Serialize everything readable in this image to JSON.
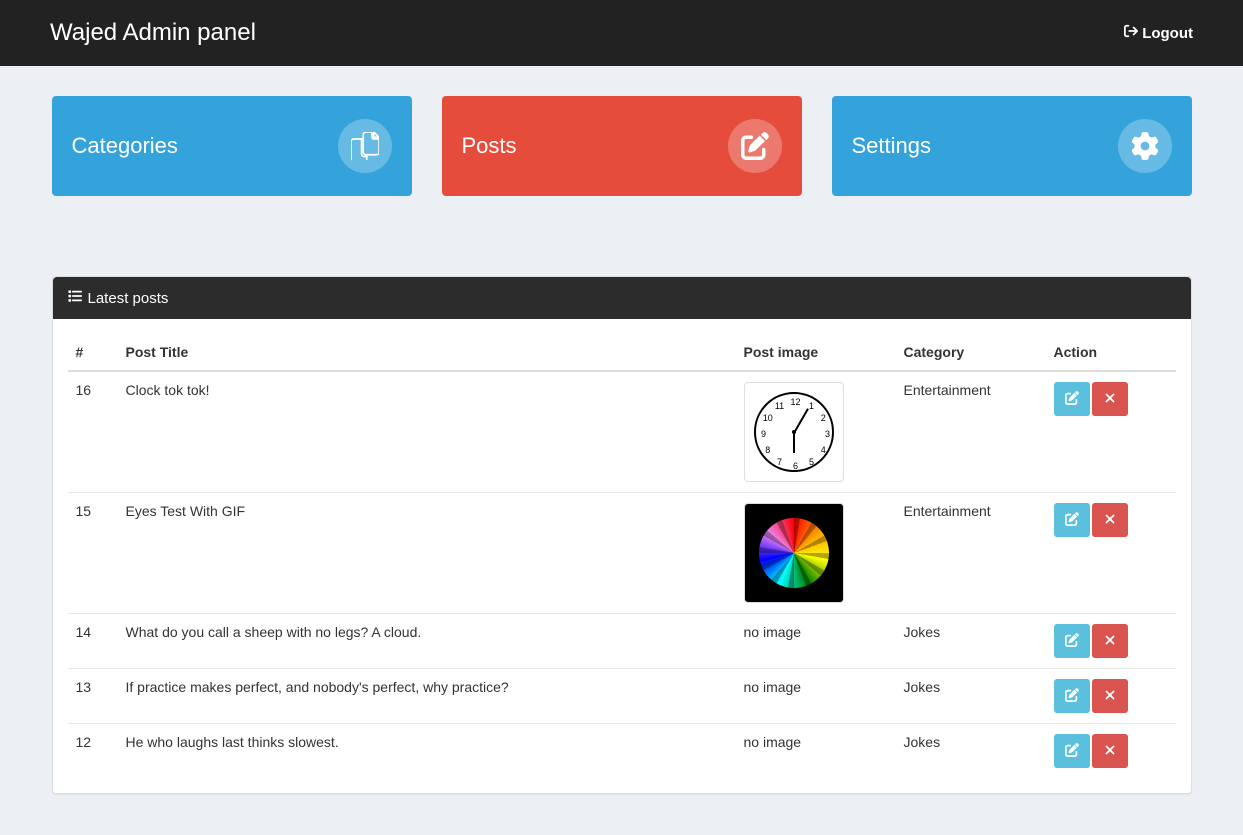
{
  "navbar": {
    "brand": "Wajed Admin panel",
    "logout": "Logout"
  },
  "widgets": {
    "categories": "Categories",
    "posts": "Posts",
    "settings": "Settings"
  },
  "panel": {
    "title": "Latest posts"
  },
  "table": {
    "headers": {
      "id": "#",
      "title": "Post Title",
      "image": "Post image",
      "category": "Category",
      "action": "Action"
    },
    "rows": [
      {
        "id": "16",
        "title": "Clock tok tok!",
        "image": "clock",
        "category": "Entertainment"
      },
      {
        "id": "15",
        "title": "Eyes Test With GIF",
        "image": "rainbow",
        "category": "Entertainment"
      },
      {
        "id": "14",
        "title": "What do you call a sheep with no legs? A cloud.",
        "image": "no image",
        "category": "Jokes"
      },
      {
        "id": "13",
        "title": "If practice makes perfect, and nobody's perfect, why practice?",
        "image": "no image",
        "category": "Jokes"
      },
      {
        "id": "12",
        "title": "He who laughs last thinks slowest.",
        "image": "no image",
        "category": "Jokes"
      }
    ]
  }
}
